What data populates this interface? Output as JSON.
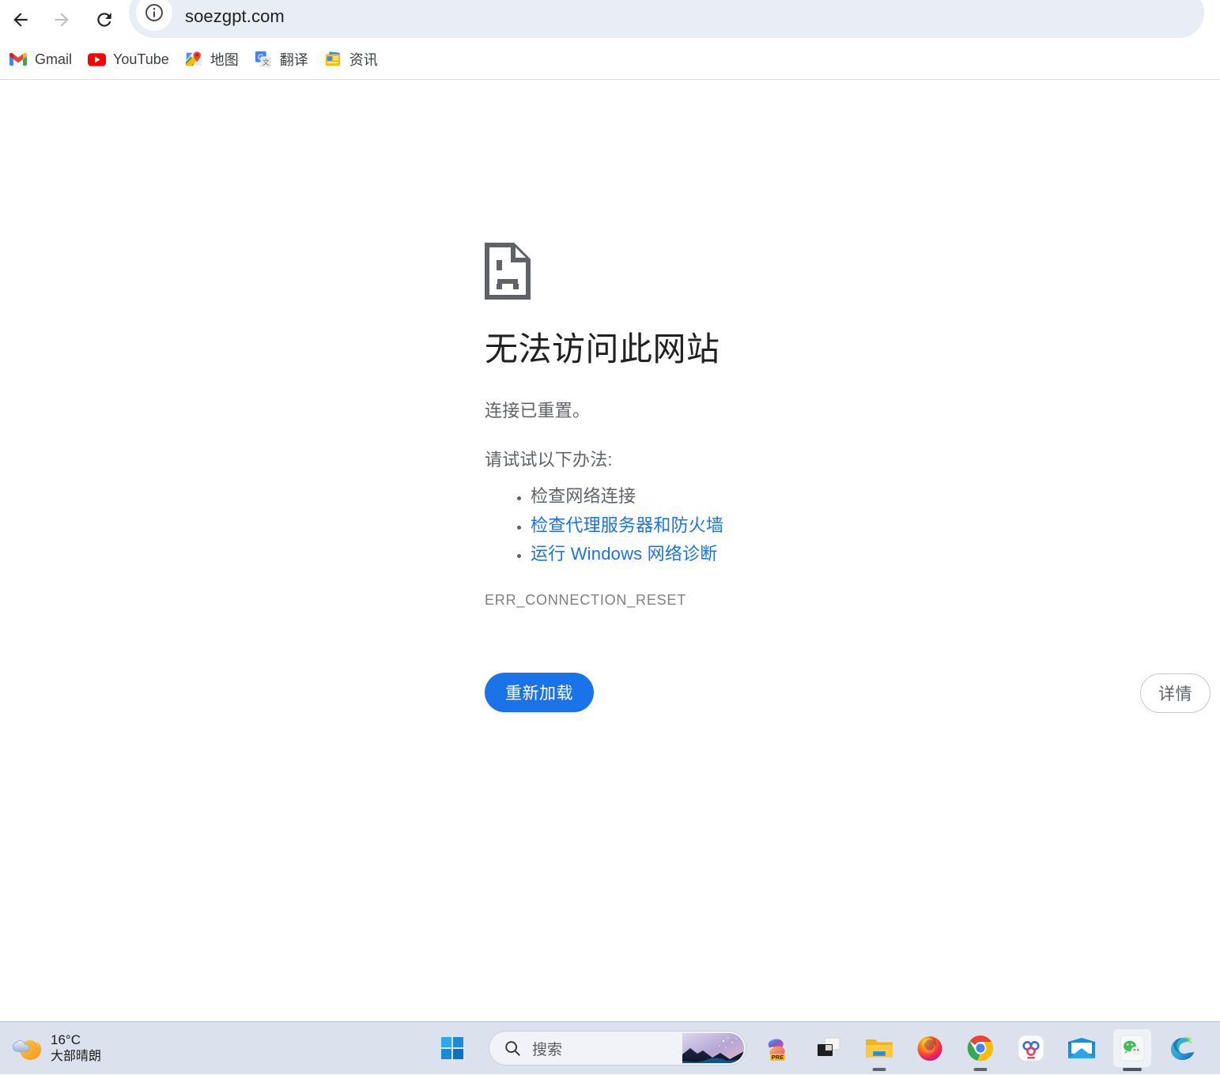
{
  "browser": {
    "nav": {
      "back_label": "返回",
      "forward_label": "前进",
      "reload_label": "重新加载此页面"
    },
    "omnibox": {
      "url": "soezgpt.com",
      "site_info_icon": "info-circle-icon"
    },
    "bookmarks": [
      {
        "label": "Gmail",
        "icon": "gmail-icon"
      },
      {
        "label": "YouTube",
        "icon": "youtube-icon"
      },
      {
        "label": "地图",
        "icon": "google-maps-icon"
      },
      {
        "label": "翻译",
        "icon": "google-translate-icon"
      },
      {
        "label": "资讯",
        "icon": "google-news-icon"
      }
    ]
  },
  "error_page": {
    "icon": "sad-page-icon",
    "title": "无法访问此网站",
    "subtitle": "连接已重置。",
    "suggestion_heading": "请试试以下办法:",
    "suggestions": [
      {
        "text": "检查网络连接",
        "is_link": false
      },
      {
        "text": "检查代理服务器和防火墙",
        "is_link": true
      },
      {
        "text": "运行 Windows 网络诊断",
        "is_link": true
      }
    ],
    "error_code": "ERR_CONNECTION_RESET",
    "reload_button": "重新加载",
    "details_button": "详情",
    "colors": {
      "link": "#1a73e8",
      "primary_button": "#1a73e8",
      "text": "#5f6368",
      "title": "#202124"
    }
  },
  "taskbar": {
    "weather": {
      "icon": "cloud-moon-icon",
      "temperature": "16°C",
      "condition": "大部晴朗"
    },
    "start_button": {
      "label": "开始",
      "icon": "windows-logo-icon"
    },
    "search": {
      "placeholder": "搜索",
      "icon": "search-icon",
      "thumbnail": "copilot-wallpaper-thumb"
    },
    "apps": [
      {
        "name": "copilot",
        "label": "Copilot",
        "badge": "PRE",
        "state": "idle"
      },
      {
        "name": "task-view",
        "label": "任务视图",
        "state": "idle"
      },
      {
        "name": "file-explorer",
        "label": "文件资源管理器",
        "state": "running"
      },
      {
        "name": "firefox",
        "label": "Firefox",
        "state": "idle"
      },
      {
        "name": "chrome",
        "label": "Google Chrome",
        "state": "running"
      },
      {
        "name": "baidu-netdisk",
        "label": "百度网盘",
        "state": "idle"
      },
      {
        "name": "mail",
        "label": "邮件",
        "state": "idle"
      },
      {
        "name": "wechat",
        "label": "微信",
        "state": "active"
      },
      {
        "name": "edge",
        "label": "Microsoft Edge",
        "state": "idle"
      }
    ]
  }
}
